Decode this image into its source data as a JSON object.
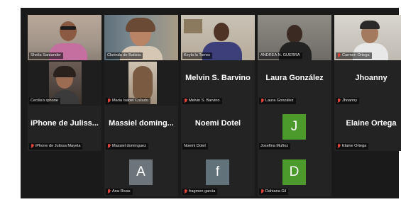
{
  "colors": {
    "background": "#1a1a1a",
    "tile": "#232323",
    "active_border": "#c9d44a",
    "muted_mic": "#e0443a",
    "avatar_gray": "#6e757a",
    "avatar_slate": "#62727b",
    "avatar_green": "#4c9a2c"
  },
  "participants": [
    {
      "name": "Sheila Santander",
      "video": true,
      "muted": false
    },
    {
      "name": "Clorinda de Batista",
      "video": true,
      "muted": false
    },
    {
      "name": "Keyla la Torres",
      "video": true,
      "muted": false
    },
    {
      "name": "ANDREA N. GUERRA",
      "video": true,
      "muted": false,
      "active_speaker": true
    },
    {
      "name": "Carmen Ortega",
      "video": true,
      "muted": true
    },
    {
      "name": "Cecilia's iphone",
      "video": true,
      "muted": false
    },
    {
      "name": "Maria Isabel Collado",
      "video": true,
      "muted": true
    },
    {
      "name": "Melvin S. Barvino",
      "display": "Melvin S. Barvino",
      "muted": true
    },
    {
      "name": "Laura González",
      "display": "Laura González",
      "muted": true
    },
    {
      "name": "Jhoanny",
      "display": "Jhoanny",
      "muted": true
    },
    {
      "name": "iPhone de Julissa Mayela",
      "display": "iPhone de Juliss...",
      "muted": true
    },
    {
      "name": "Massiel dominguez",
      "display": "Massiel doming...",
      "muted": true
    },
    {
      "name": "Noemi Dotel",
      "display": "Noemi Dotel",
      "muted": false
    },
    {
      "name": "Josefina Muñoz",
      "avatar_letter": "J",
      "muted": false
    },
    {
      "name": "Elaine Ortega",
      "display": "Elaine Ortega",
      "muted": true
    },
    {
      "name": "Ana Rivas",
      "avatar_letter": "A",
      "muted": true
    },
    {
      "name": "fragmen garcia",
      "avatar_letter": "f",
      "muted": true
    },
    {
      "name": "Dahiana Gil",
      "avatar_letter": "D",
      "muted": true
    }
  ]
}
